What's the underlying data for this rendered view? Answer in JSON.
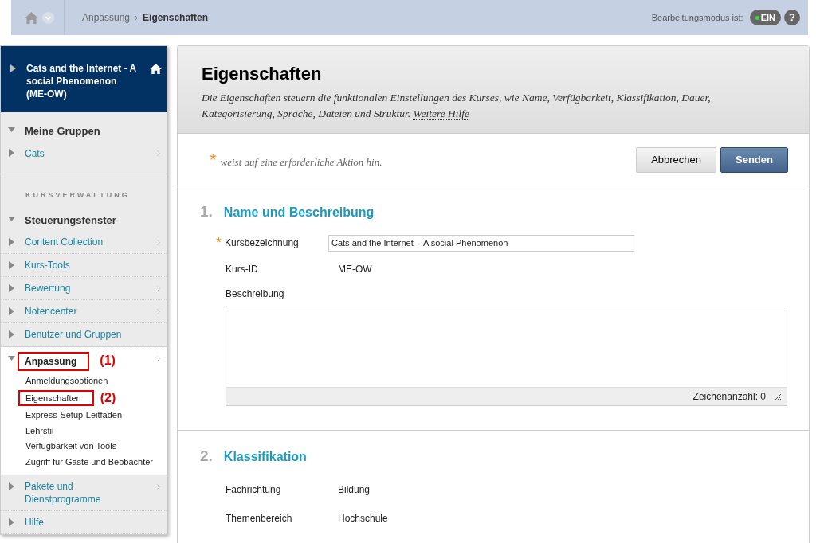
{
  "top_bar": {
    "breadcrumb": [
      {
        "label": "Anpassung",
        "current": false
      },
      {
        "label": "Eigenschaften",
        "current": true
      }
    ],
    "edit_mode_label": "Bearbeitungsmodus ist:",
    "edit_mode": {
      "label": "EIN",
      "on": true
    },
    "help": "?"
  },
  "sidebar": {
    "course_title": "Cats and the Internet - A social Phenomenon (ME-OW)",
    "groups": {
      "heading": "Meine Gruppen",
      "expanded": true,
      "items": [
        {
          "label": "Cats",
          "has_submenu": true
        }
      ]
    },
    "admin": {
      "section_label": "KURSVERWALTUNG",
      "heading": "Steuerungsfenster",
      "expanded": true,
      "items": [
        {
          "label": "Content Collection",
          "has_submenu": true,
          "expanded": false
        },
        {
          "label": "Kurs-Tools",
          "has_submenu": false,
          "expanded": false
        },
        {
          "label": "Bewertung",
          "has_submenu": true,
          "expanded": false
        },
        {
          "label": "Notencenter",
          "has_submenu": true,
          "expanded": false
        },
        {
          "label": "Benutzer und Gruppen",
          "has_submenu": false,
          "expanded": false
        },
        {
          "label": "Anpassung",
          "has_submenu": true,
          "expanded": true,
          "annotation": "(1)",
          "children": [
            {
              "label": "Anmeldungsoptionen"
            },
            {
              "label": "Eigenschaften",
              "annotation": "(2)"
            },
            {
              "label": "Express-Setup-Leitfaden"
            },
            {
              "label": "Lehrstil"
            },
            {
              "label": "Verfügbarkeit von Tools"
            },
            {
              "label": "Zugriff für Gäste und Beobachter"
            }
          ]
        },
        {
          "label": "Pakete und Dienstprogramme",
          "has_submenu": true,
          "expanded": false
        },
        {
          "label": "Hilfe",
          "has_submenu": false,
          "expanded": false
        }
      ]
    }
  },
  "main": {
    "title": "Eigenschaften",
    "description": "Die Eigenschaften steuern die funktionalen Einstellungen des Kurses, wie Name, Verfügbarkeit, Klassifikation, Dauer, Kategorisierung, Sprache, Dateien und Struktur.",
    "help_link": "Weitere Hilfe",
    "required_mark": "*",
    "required_note": "weist auf eine erforderliche Aktion hin.",
    "buttons": [
      {
        "label": "Abbrechen",
        "kind": "secondary"
      },
      {
        "label": "Senden",
        "kind": "primary"
      }
    ],
    "sections": [
      {
        "number": "1.",
        "title": "Name und Beschreibung",
        "fields": [
          {
            "kind": "input",
            "label": "Kursbezeichnung",
            "required": true,
            "value": "Cats and the Internet -  A social Phenomenon"
          },
          {
            "kind": "static",
            "label": "Kurs-ID",
            "value": "ME-OW"
          },
          {
            "kind": "textarea",
            "label": "Beschreibung",
            "counter": "Zeichenanzahl: 0"
          }
        ]
      },
      {
        "number": "2.",
        "title": "Klassifikation",
        "fields": [
          {
            "kind": "static",
            "label": "Fachrichtung",
            "value": "Bildung"
          },
          {
            "kind": "static",
            "label": "Themenbereich",
            "value": "Hochschule"
          }
        ]
      }
    ]
  }
}
